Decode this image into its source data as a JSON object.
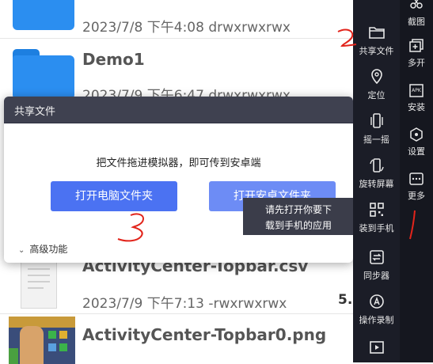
{
  "files": [
    {
      "meta": "2023/7/8 下午4:08   drwxrwxrwx"
    },
    {
      "name": "Demo1",
      "meta": "2023/7/9 下午6:47   drwxrwxrwx"
    },
    {
      "name": "ActivityCenter-Topbar.csv",
      "meta": "2023/7/9 下午7:13   -rwxrwxrwx",
      "size": "5."
    },
    {
      "name": "ActivityCenter-Topbar0.png"
    }
  ],
  "dialog": {
    "title": "共享文件",
    "message": "把文件拖进模拟器，即可传到安卓端",
    "primary_button": "打开电脑文件夹",
    "secondary_button": "打开安卓文件夹",
    "advanced": "高级功能"
  },
  "tooltip": {
    "line1": "请先打开你要下",
    "line2": "载到手机的应用"
  },
  "toolbar": {
    "items": [
      {
        "label": "共享文件",
        "icon": "folder-icon"
      },
      {
        "label": "定位",
        "icon": "location-icon"
      },
      {
        "label": "摇一摇",
        "icon": "shake-icon"
      },
      {
        "label": "旋转屏幕",
        "icon": "rotate-icon"
      },
      {
        "label": "装到手机",
        "icon": "qr-icon"
      },
      {
        "label": "同步器",
        "icon": "sync-icon"
      },
      {
        "label": "操作录制",
        "icon": "record-icon"
      }
    ],
    "secondary": [
      {
        "label": "截图",
        "icon": "scissors-icon"
      },
      {
        "label": "多开",
        "icon": "multi-instance-icon"
      },
      {
        "label": "安装",
        "icon": "apk-icon"
      },
      {
        "label": "设置",
        "icon": "settings-icon"
      },
      {
        "label": "更多",
        "icon": "more-icon"
      }
    ]
  },
  "colors": {
    "accent": "#4b72f2",
    "toolbar_bg": "#1b1d27",
    "annotation": "#e2241b",
    "folder": "#2b8ef0"
  }
}
